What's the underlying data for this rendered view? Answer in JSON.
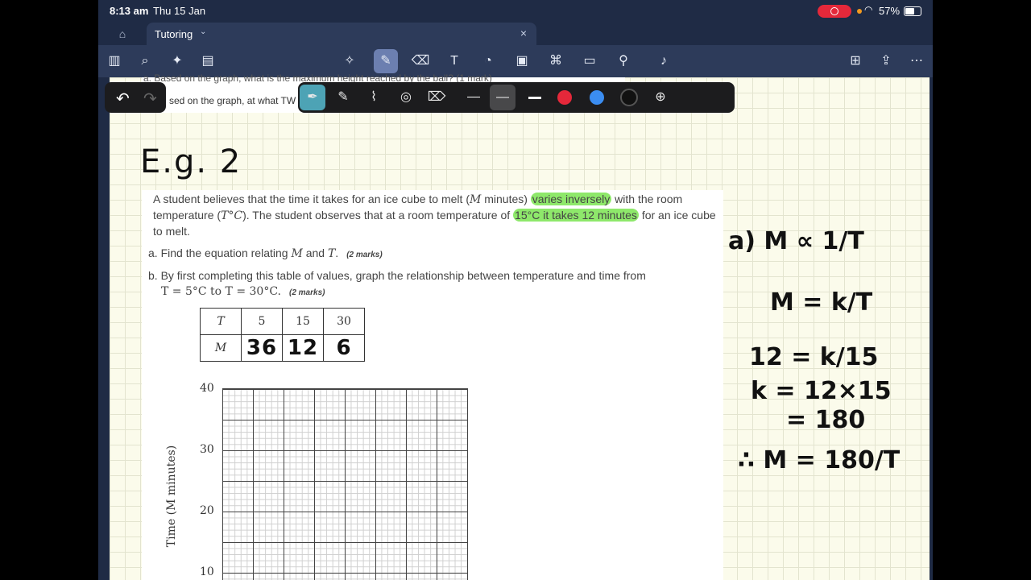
{
  "status": {
    "time": "8:13 am",
    "date": "Thu 15 Jan",
    "battery": "57%"
  },
  "tab": {
    "title": "Tutoring",
    "close": "×"
  },
  "toolbar_icons": [
    "sidebar-icon",
    "search-icon",
    "sparkle-icon",
    "document-icon",
    "lasso-icon",
    "pen-icon",
    "eraser-icon",
    "textbox-icon",
    "shapes-icon",
    "image-icon",
    "stickers-icon",
    "notes-icon",
    "ruler-icon",
    "mic-icon",
    "add-page-icon",
    "share-icon",
    "more-icon"
  ],
  "scrap": {
    "line1": "a. Based on the graph, what is the maximum height reached by the ball? (1 mark)",
    "line2": "sed on the graph, at what TW"
  },
  "handwriting": {
    "heading": "E.g. 2",
    "lines": [
      "a) M ∝ 1/T",
      "M = k/T",
      "12 = k/15",
      "k = 12×15",
      "= 180",
      "∴ M = 180/T"
    ],
    "table_M": [
      "36",
      "12",
      "6"
    ]
  },
  "question": {
    "p1": "A student believes that the time it takes for an ice cube to melt (",
    "p2": "M",
    "p3": " minutes) ",
    "p4": "varies inversely",
    "p5": " with the room temperature (",
    "p6": "T°C",
    "p7": "). The student observes that at a room temperature of ",
    "p8": "15°C it takes 12 minutes",
    "p9": " for an ice cube to melt.",
    "a_pre": "a. Find the equation relating ",
    "a_M": "M",
    "a_and": " and ",
    "a_T": "T",
    "a_post": ".",
    "a_marks": "(2 marks)",
    "b1": "b. By first completing this table of values, graph the relationship between temperature and time from",
    "b2": "T = 5°C to T = 30°C.",
    "b_marks": "(2 marks)"
  },
  "table": {
    "row_T_label": "T",
    "row_M_label": "M",
    "T_values": [
      "5",
      "15",
      "30"
    ]
  },
  "graph": {
    "ylabel": "Time (M minutes)",
    "yticks": [
      "40",
      "30",
      "20",
      "10"
    ]
  },
  "colors": {
    "highlight": "#8ee86b",
    "tool_selected": "#4da3b5",
    "red": "#e5283a",
    "blue": "#3b8df1"
  }
}
